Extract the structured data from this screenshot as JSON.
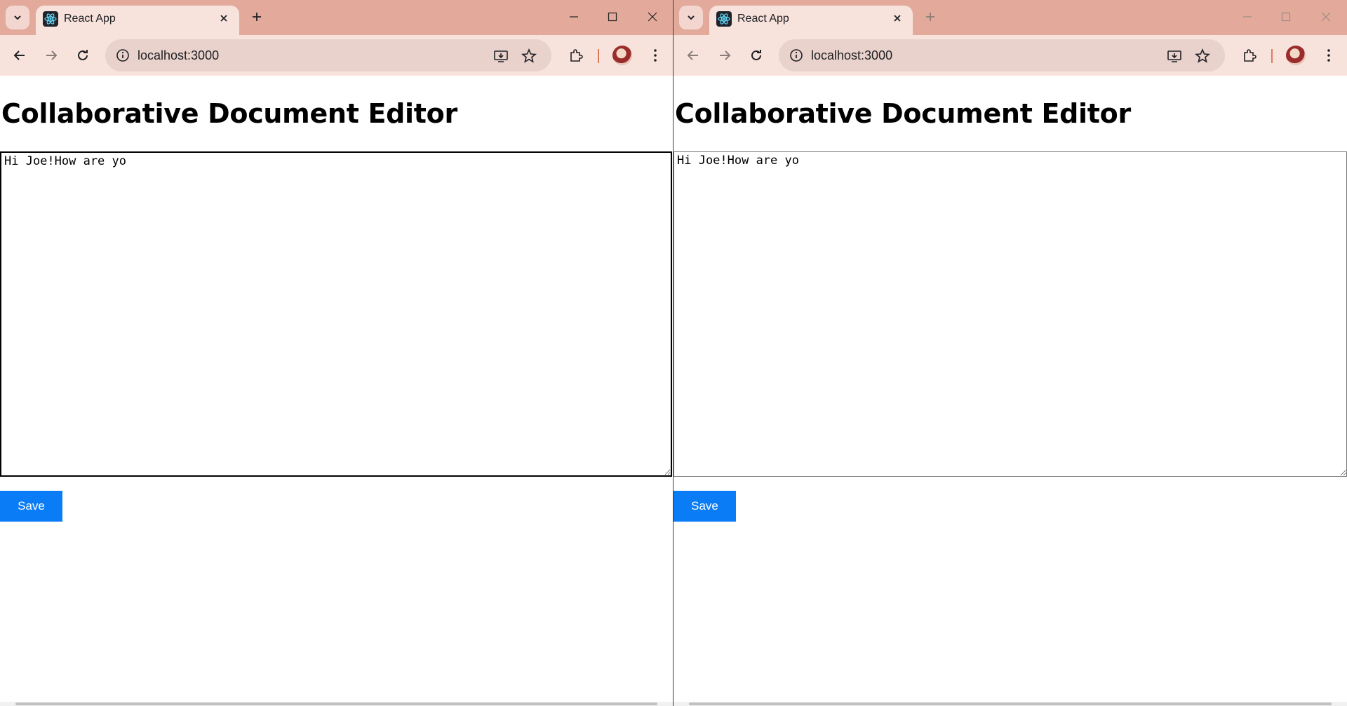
{
  "windows": [
    {
      "id": "left",
      "tab": {
        "title": "React App"
      },
      "address_bar": {
        "url": "localhost:3000"
      },
      "page": {
        "heading": "Collaborative Document Editor",
        "editor_text": "Hi Joe!How are yo",
        "save_label": "Save"
      },
      "active": true
    },
    {
      "id": "right",
      "tab": {
        "title": "React App"
      },
      "address_bar": {
        "url": "localhost:3000"
      },
      "page": {
        "heading": "Collaborative Document Editor",
        "editor_text": "Hi Joe!How are yo",
        "save_label": "Save"
      },
      "active": false
    }
  ],
  "colors": {
    "tabstrip": "#e3aa9b",
    "toolbar": "#f7e2dc",
    "save_button": "#0a7cf5"
  }
}
